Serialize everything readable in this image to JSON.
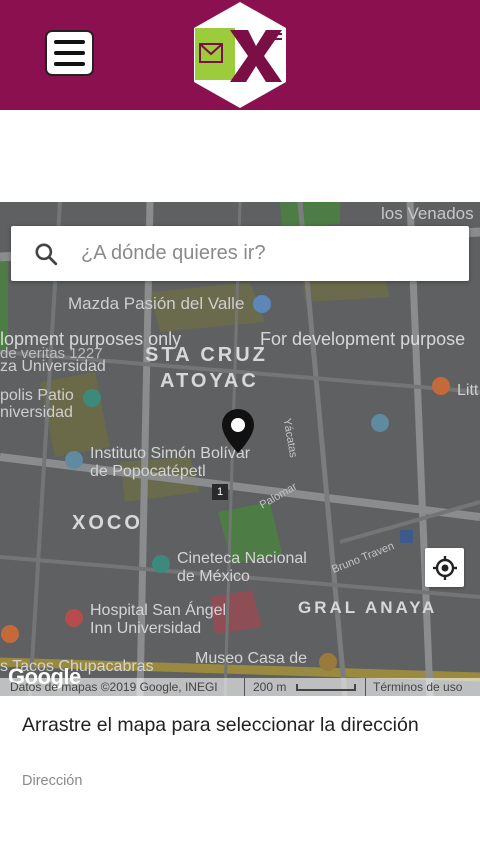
{
  "header": {
    "brand_color": "#8b1050",
    "logo_text": "X"
  },
  "search": {
    "placeholder": "¿A dónde quieres ir?"
  },
  "map": {
    "labels": {
      "venados": "los Venados",
      "mazda": "Mazda Pasión del Valle",
      "dev_left": "lopment purposes only",
      "dev_right": "For development purpose",
      "sta_cruz": "STA CRUZ",
      "atoyac": "ATOYAC",
      "universidad1": "za Universidad",
      "patio": "polis Patio",
      "universidad2": "niversidad",
      "instituto1": "Instituto Simón Bolívar",
      "instituto2": "de Popocatépetl",
      "xoco": "XOCO",
      "cineteca1": "Cineteca Nacional",
      "cineteca2": "de México",
      "hospital1": "Hospital San Ángel",
      "hospital2": "Inn Universidad",
      "graal": "GRAL ANAYA",
      "museo": "Museo Casa de",
      "tacos": "s Tacos Chupacabras",
      "palomar": "Palomar",
      "yacatas": "Yácatas",
      "bruno": "Bruno Traven",
      "lit": "Litt",
      "deveritas": "de veritas 1227",
      "route": "1"
    },
    "google_logo": "Google",
    "attribution": "Datos de mapas ©2019 Google, INEGI",
    "scale": "200 m",
    "terms": "Términos de uso"
  },
  "instruction": "Arrastre el mapa para seleccionar la dirección",
  "address": {
    "label": "Dirección",
    "value": ""
  },
  "icons": {
    "menu": "menu-icon",
    "search": "search-icon",
    "pin": "map-pin-icon",
    "locate": "my-location-icon"
  }
}
